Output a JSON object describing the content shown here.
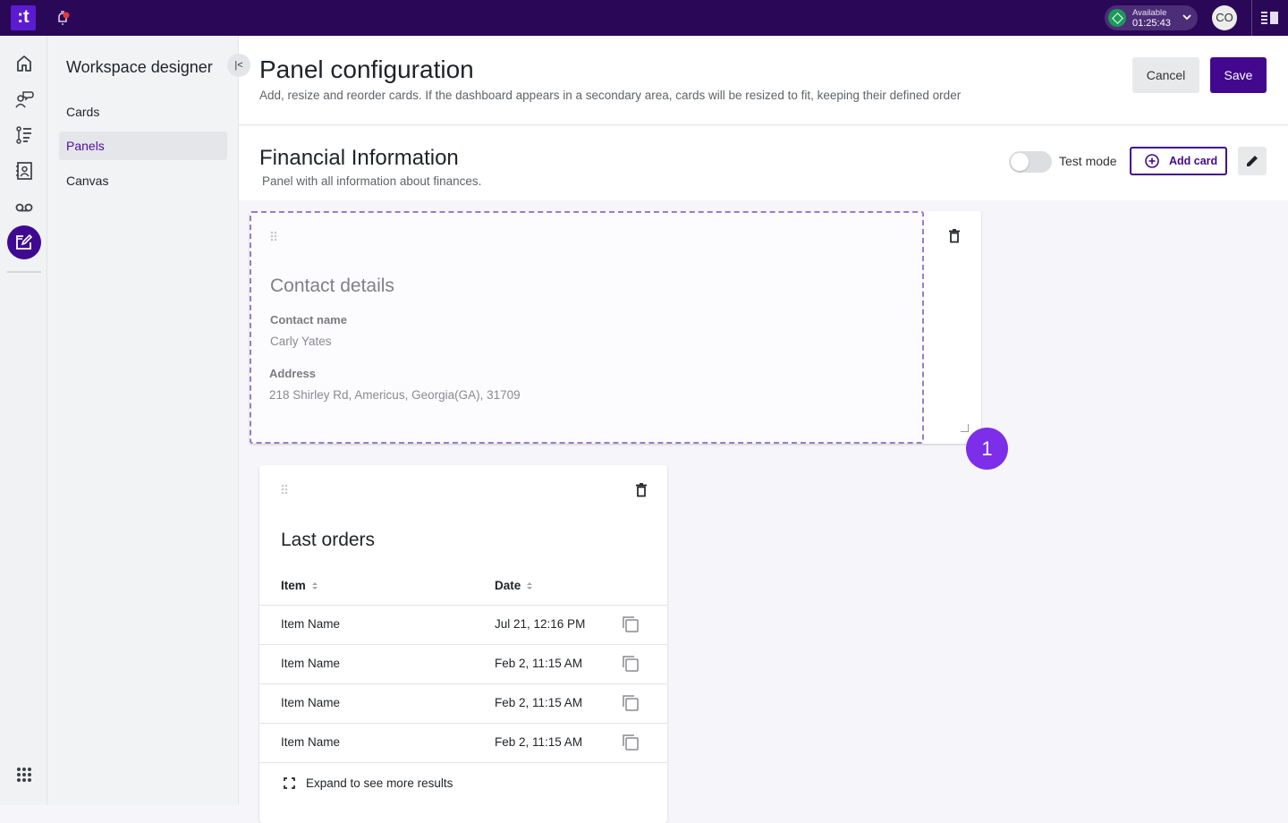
{
  "topbar": {
    "logo_text": ":t",
    "status": {
      "label": "Available",
      "timer": "01:25:43",
      "color": "#1a9a5a"
    },
    "avatar_initials": "CO"
  },
  "rail": {
    "items": [
      {
        "icon": "home-icon"
      },
      {
        "icon": "conversation-agent-icon"
      },
      {
        "icon": "queue-list-icon"
      },
      {
        "icon": "contacts-book-icon"
      },
      {
        "icon": "voicemail-icon"
      },
      {
        "icon": "workspace-designer-icon",
        "active": true
      }
    ],
    "bottom_icon": "apps-grid-icon"
  },
  "subnav": {
    "title": "Workspace designer",
    "items": [
      {
        "label": "Cards",
        "active": false
      },
      {
        "label": "Panels",
        "active": true
      },
      {
        "label": "Canvas",
        "active": false
      }
    ]
  },
  "page": {
    "title": "Panel configuration",
    "description": "Add, resize and reorder cards. If the dashboard appears in a secondary area, cards will be resized to fit, keeping their defined order",
    "cancel_label": "Cancel",
    "save_label": "Save"
  },
  "panel": {
    "title": "Financial Information",
    "description": "Panel with all information about finances.",
    "test_mode_label": "Test mode",
    "test_mode_on": false,
    "add_card_label": "Add card"
  },
  "contact_card": {
    "title": "Contact details",
    "fields": [
      {
        "label": "Contact name",
        "value": "Carly Yates"
      },
      {
        "label": "Address",
        "value": "218 Shirley Rd, Americus, Georgia(GA), 31709"
      }
    ],
    "badge": "1"
  },
  "orders_card": {
    "title": "Last orders",
    "columns": [
      "Item",
      "Date"
    ],
    "rows": [
      {
        "item": "Item Name",
        "date": "Jul 21, 12:16 PM"
      },
      {
        "item": "Item Name",
        "date": "Feb 2, 11:15 AM"
      },
      {
        "item": "Item Name",
        "date": "Feb 2, 11:15 AM"
      },
      {
        "item": "Item Name",
        "date": "Feb 2, 11:15 AM"
      }
    ],
    "expand_label": "Expand to see more results"
  },
  "colors": {
    "brand_dark": "#2a0757",
    "primary": "#42098f",
    "accent": "#7c2ee8",
    "dashed_outline": "#9b7bc9"
  }
}
